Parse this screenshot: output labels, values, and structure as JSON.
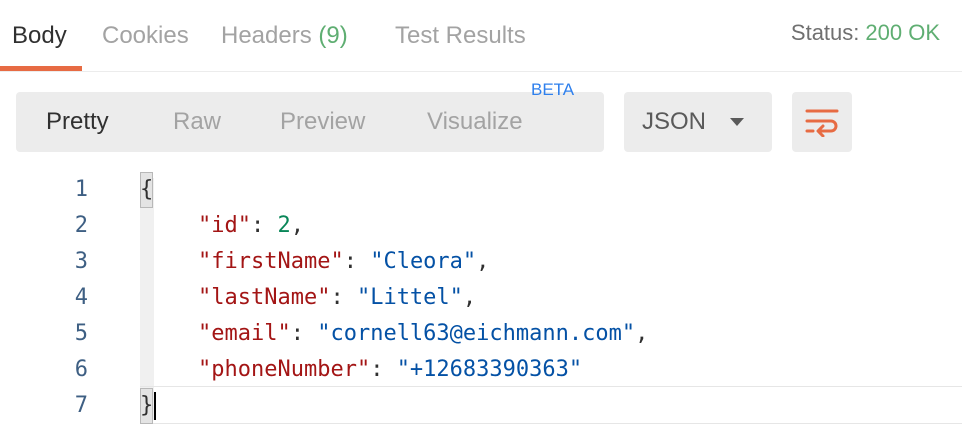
{
  "response_tabs": {
    "body": "Body",
    "cookies": "Cookies",
    "headers": "Headers",
    "headers_count": "(9)",
    "test_results": "Test Results"
  },
  "status": {
    "label": "Status:",
    "value": "200 OK"
  },
  "view_modes": {
    "pretty": "Pretty",
    "raw": "Raw",
    "preview": "Preview",
    "visualize": "Visualize",
    "beta_badge": "BETA"
  },
  "format": {
    "selected": "JSON"
  },
  "editor": {
    "line_numbers": [
      "1",
      "2",
      "3",
      "4",
      "5",
      "6",
      "7"
    ],
    "open_brace": "{",
    "close_brace": "}",
    "fields": [
      {
        "key": "\"id\"",
        "sep": ": ",
        "value": "2",
        "trail": ","
      },
      {
        "key": "\"firstName\"",
        "sep": ": ",
        "value": "\"Cleora\"",
        "trail": ","
      },
      {
        "key": "\"lastName\"",
        "sep": ": ",
        "value": "\"Littel\"",
        "trail": ","
      },
      {
        "key": "\"email\"",
        "sep": ": ",
        "value": "\"cornell63@eichmann.com\"",
        "trail": ","
      },
      {
        "key": "\"phoneNumber\"",
        "sep": ": ",
        "value": "\"+12683390363\"",
        "trail": ""
      }
    ]
  },
  "colors": {
    "accent": "#e76b43",
    "status_ok": "#5fae72",
    "json_key": "#a31515",
    "json_string": "#0451a5",
    "json_number": "#098658",
    "beta": "#2f80ed"
  },
  "icons": {
    "wrap": "wrap-lines-icon",
    "dropdown": "chevron-down-icon"
  }
}
